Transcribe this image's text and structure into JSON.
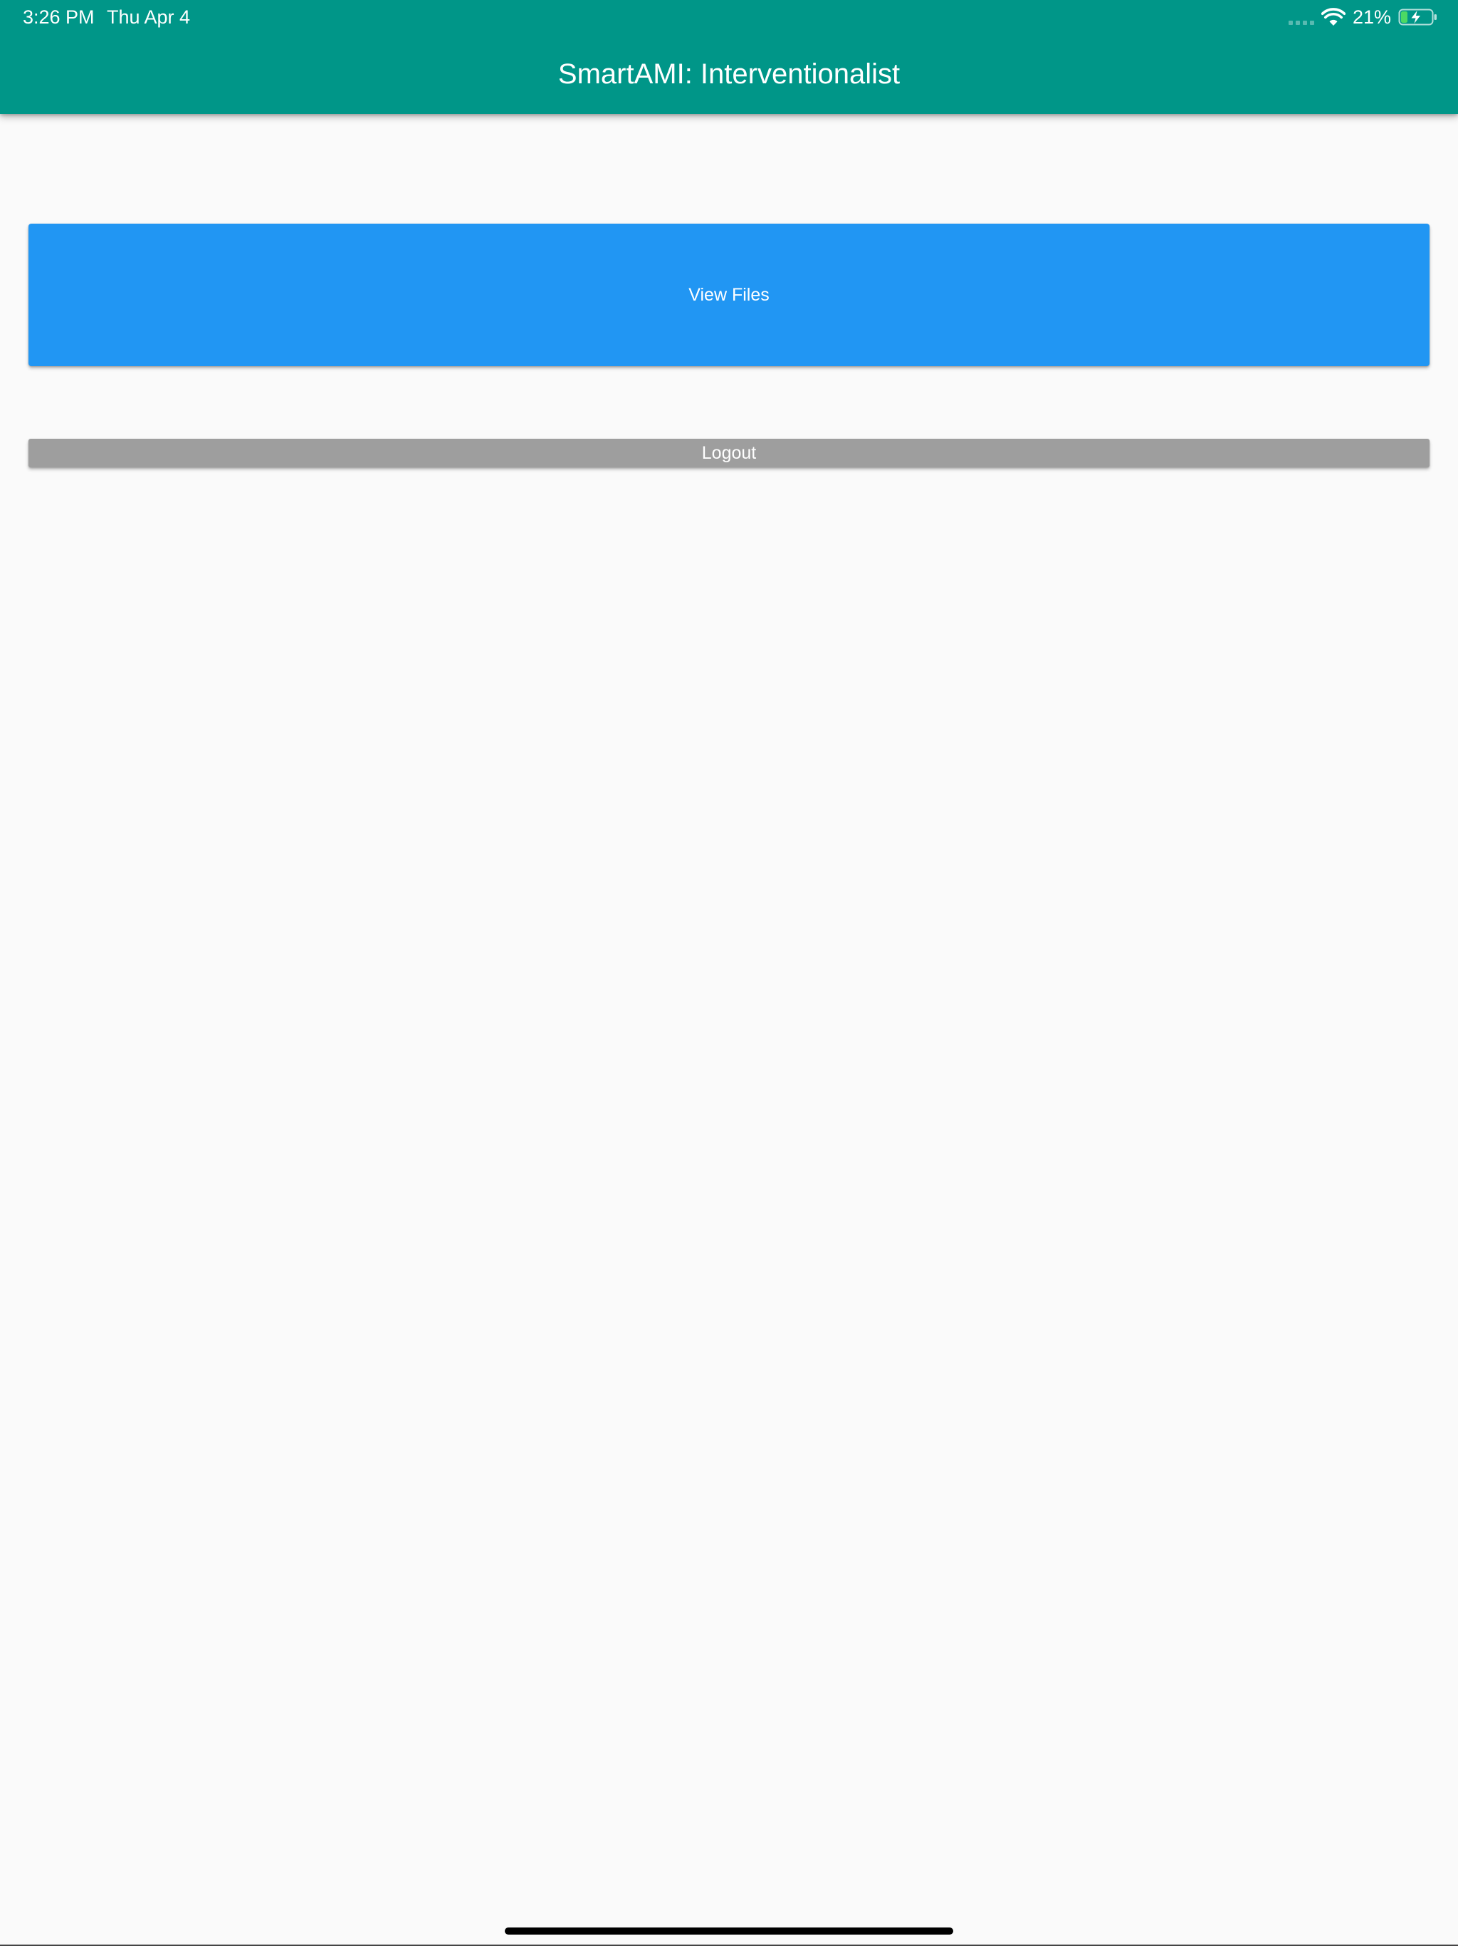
{
  "status_bar": {
    "time": "3:26 PM",
    "date": "Thu Apr 4",
    "battery_percent": "21%",
    "battery_level": 0.21,
    "icons": [
      "cellular-signal-icon",
      "wifi-icon",
      "battery-charging-icon"
    ]
  },
  "app_bar": {
    "title": "SmartAMI: Interventionalist",
    "color": "#009688"
  },
  "main": {
    "view_files_label": "View Files",
    "view_files_color": "#2196f3",
    "logout_label": "Logout",
    "logout_color": "#9e9e9e"
  }
}
